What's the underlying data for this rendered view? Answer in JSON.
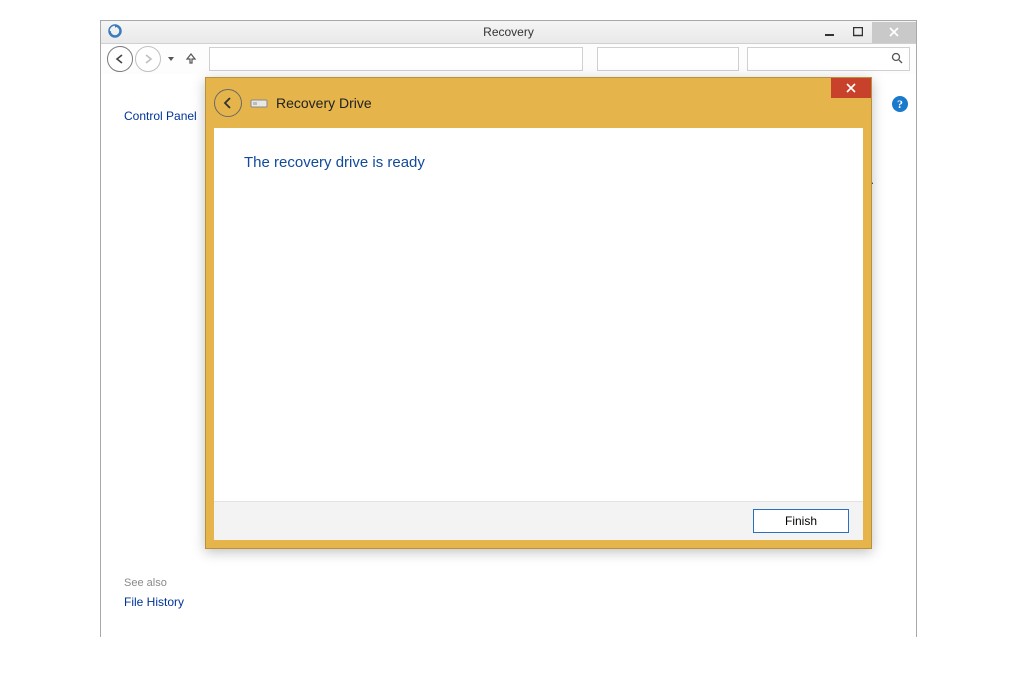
{
  "parent": {
    "title": "Recovery",
    "breadcrumb_link": "Control Panel",
    "truncated_marker": ".",
    "help_tooltip": "?",
    "see_also_label": "See also",
    "see_also_link": "File History"
  },
  "wizard": {
    "title": "Recovery Drive",
    "heading": "The recovery drive is ready",
    "finish_label": "Finish"
  }
}
